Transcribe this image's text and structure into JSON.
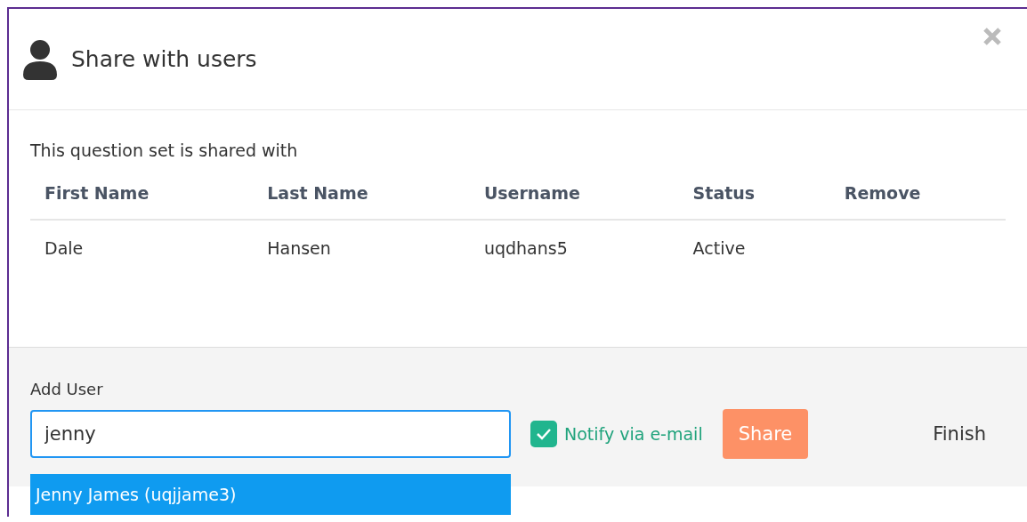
{
  "dialog": {
    "title": "Share with users"
  },
  "intro": "This question set is shared with",
  "table": {
    "columns": [
      "First Name",
      "Last Name",
      "Username",
      "Status",
      "Remove"
    ],
    "rows": [
      [
        "Dale",
        "Hansen",
        "uqdhans5",
        "Active"
      ]
    ]
  },
  "add_user": {
    "label": "Add User",
    "value": "jenny",
    "suggestions": [
      {
        "label": "Jenny James (uqjjame3)",
        "selected": true
      }
    ]
  },
  "notify": {
    "label": "Notify via e-mail",
    "checked": true
  },
  "buttons": {
    "share": "Share",
    "finish": "Finish"
  }
}
